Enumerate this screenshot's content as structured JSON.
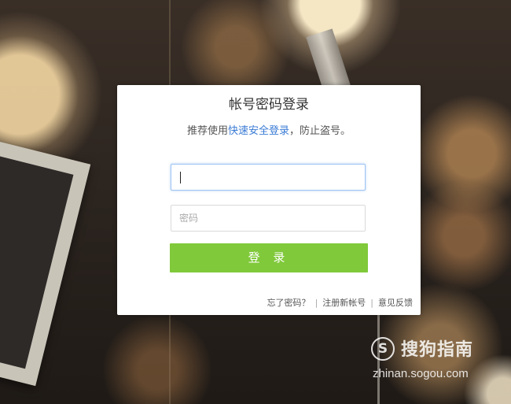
{
  "dialog": {
    "title": "帐号密码登录",
    "subtitle_prefix": "推荐使用",
    "subtitle_link": "快速安全登录",
    "subtitle_suffix": "，防止盗号。",
    "account_value": "",
    "password_placeholder": "密码",
    "login_label": "登 录",
    "footer": {
      "forgot": "忘了密码？",
      "separator": "|",
      "register": "注册新帐号",
      "feedback": "意见反馈"
    }
  },
  "watermark": {
    "logo_icon": "S",
    "name": "搜狗指南",
    "url": "zhinan.sogou.com"
  },
  "colors": {
    "login_button": "#80c93a",
    "link": "#3a7bd5",
    "focus_border": "#9dc3f2"
  }
}
